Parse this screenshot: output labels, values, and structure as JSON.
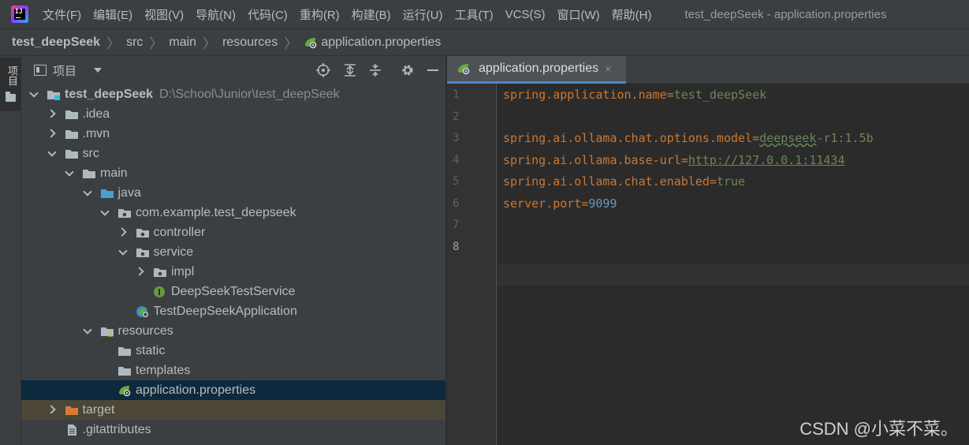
{
  "menu": {
    "items": [
      "文件(F)",
      "编辑(E)",
      "视图(V)",
      "导航(N)",
      "代码(C)",
      "重构(R)",
      "构建(B)",
      "运行(U)",
      "工具(T)",
      "VCS(S)",
      "窗口(W)",
      "帮助(H)"
    ],
    "window_title": "test_deepSeek - application.properties"
  },
  "breadcrumb": {
    "items": [
      "test_deepSeek",
      "src",
      "main",
      "resources",
      "application.properties"
    ]
  },
  "tool_stripe": {
    "label": "项目"
  },
  "project_panel": {
    "title": "项目",
    "tree": [
      {
        "label": "test_deepSeek",
        "hint": "D:\\School\\Junior\\test_deepSeek",
        "icon": "module-folder-icon",
        "arrow": "down",
        "level": 0,
        "bold": true
      },
      {
        "label": ".idea",
        "icon": "folder-icon",
        "arrow": "right",
        "level": 1
      },
      {
        "label": ".mvn",
        "icon": "folder-icon",
        "arrow": "right",
        "level": 1
      },
      {
        "label": "src",
        "icon": "folder-icon",
        "arrow": "down",
        "level": 1
      },
      {
        "label": "main",
        "icon": "folder-icon",
        "arrow": "down",
        "level": 2
      },
      {
        "label": "java",
        "icon": "source-folder-icon",
        "arrow": "down",
        "level": 3
      },
      {
        "label": "com.example.test_deepseek",
        "icon": "package-icon",
        "arrow": "down",
        "level": 4
      },
      {
        "label": "controller",
        "icon": "package-icon",
        "arrow": "right",
        "level": 5
      },
      {
        "label": "service",
        "icon": "package-icon",
        "arrow": "down",
        "level": 5
      },
      {
        "label": "impl",
        "icon": "package-icon",
        "arrow": "right",
        "level": 6
      },
      {
        "label": "DeepSeekTestService",
        "icon": "interface-icon",
        "arrow": "none",
        "level": 6
      },
      {
        "label": "TestDeepSeekApplication",
        "icon": "spring-boot-app-icon",
        "arrow": "none",
        "level": 5
      },
      {
        "label": "resources",
        "icon": "resources-folder-icon",
        "arrow": "down",
        "level": 3
      },
      {
        "label": "static",
        "icon": "folder-icon",
        "arrow": "none",
        "level": 4
      },
      {
        "label": "templates",
        "icon": "folder-icon",
        "arrow": "none",
        "level": 4
      },
      {
        "label": "application.properties",
        "icon": "spring-properties-icon",
        "arrow": "none",
        "level": 4,
        "selected": true
      },
      {
        "label": "target",
        "icon": "excluded-folder-icon",
        "arrow": "right",
        "level": 1,
        "excluded": true
      },
      {
        "label": ".gitattributes",
        "icon": "text-file-icon",
        "arrow": "none",
        "level": 1
      }
    ]
  },
  "editor": {
    "tab": {
      "label": "application.properties",
      "close": "×"
    },
    "current_line": 8,
    "line_numbers": [
      "1",
      "2",
      "3",
      "4",
      "5",
      "6",
      "7",
      "8"
    ],
    "lines": [
      {
        "key": "spring.application.name",
        "eq": "=",
        "value": "test_deepSeek",
        "kind": "text"
      },
      {
        "key": "",
        "eq": "",
        "value": "",
        "kind": "empty"
      },
      {
        "key": "spring.ai.ollama.chat.options.model",
        "eq": "=",
        "value_a": "deepseek",
        "value_b": "-r1:1.5b",
        "kind": "squiggle"
      },
      {
        "key": "spring.ai.ollama.base-url",
        "eq": "=",
        "value": "http://127.0.0.1:11434",
        "kind": "link"
      },
      {
        "key": "spring.ai.ollama.chat.enabled",
        "eq": "=",
        "value": "true",
        "kind": "text"
      },
      {
        "key": "server.port",
        "eq": "=",
        "value": "9099",
        "kind": "number"
      },
      {
        "key": "",
        "eq": "",
        "value": "",
        "kind": "empty"
      },
      {
        "key": "",
        "eq": "",
        "value": "",
        "kind": "empty"
      }
    ]
  },
  "watermark": "CSDN @小菜不菜。"
}
